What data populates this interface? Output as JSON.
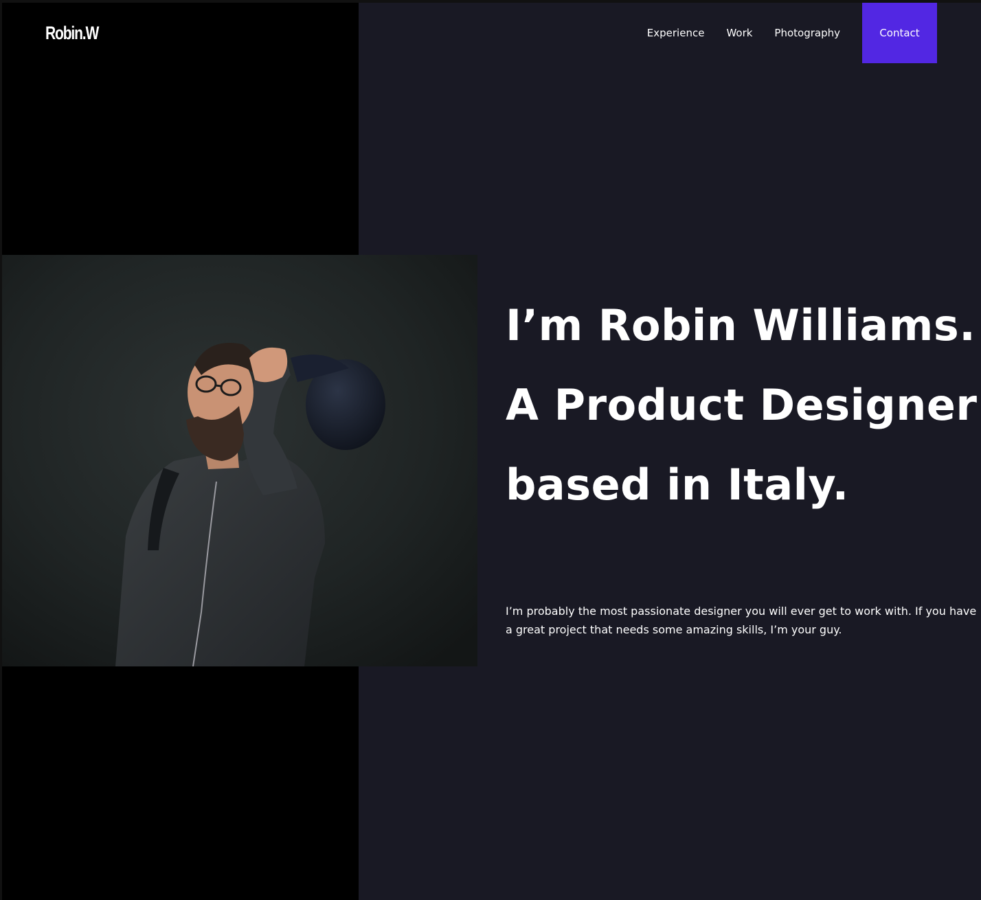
{
  "header": {
    "logo_text": "Robin.W",
    "nav": [
      {
        "label": "Experience"
      },
      {
        "label": "Work"
      },
      {
        "label": "Photography"
      }
    ],
    "contact_label": "Contact"
  },
  "hero": {
    "title": "I’m Robin Williams. A Product Designer based in Italy.",
    "subtitle": "I’m probably the most passionate designer you will ever get to work with. If you have a great project that needs some amazing skills, I’m your guy."
  },
  "colors": {
    "page_bg": "#191924",
    "left_panel": "#000000",
    "accent": "#5227e3",
    "text": "#ffffff"
  }
}
